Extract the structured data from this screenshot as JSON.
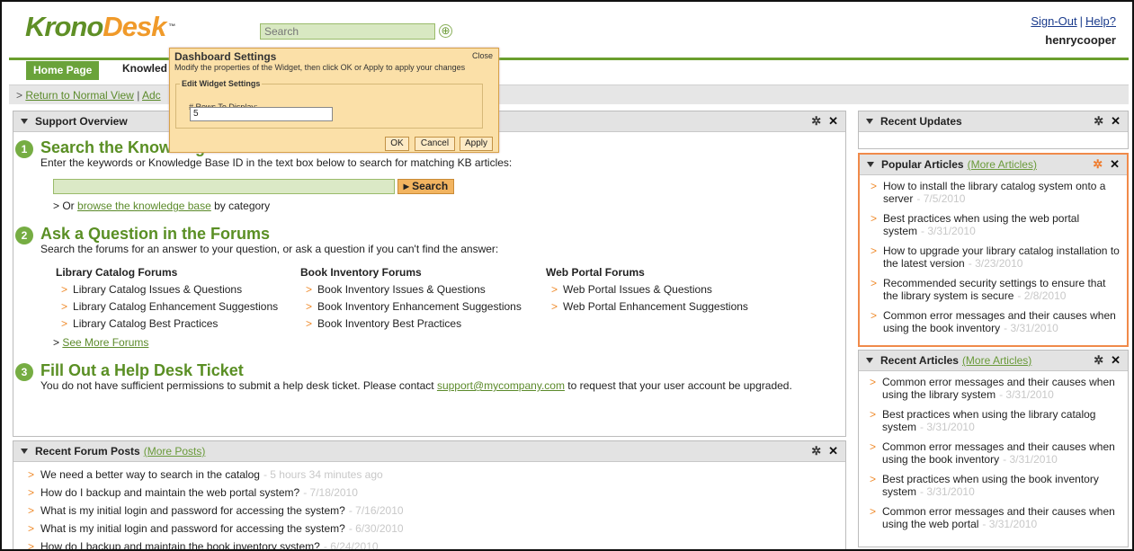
{
  "header": {
    "logo_part1": "Krono",
    "logo_part2": "Desk",
    "logo_tm": "™",
    "search_placeholder": "Search",
    "signout": "Sign-Out",
    "separator": "|",
    "help": "Help?",
    "username": "henrycooper"
  },
  "nav": {
    "home_tab": "Home Page",
    "kb_tab": "Knowled"
  },
  "breadcrumb": {
    "prefix": ">",
    "return_link": "Return to Normal View",
    "sep": "|",
    "add_link": "Adc"
  },
  "dialog": {
    "title": "Dashboard Settings",
    "close": "Close",
    "message": "Modify the properties of the Widget, then click OK or Apply to apply your changes",
    "legend": "Edit Widget Settings",
    "rows_label": "# Rows To Display:",
    "rows_value": "5",
    "ok": "OK",
    "cancel": "Cancel",
    "apply": "Apply"
  },
  "support": {
    "title": "Support Overview",
    "step1": {
      "num": "1",
      "title": "Search the Knowledge Base",
      "desc": "Enter the keywords or Knowledge Base ID in the text box below to search for matching KB articles:",
      "button": "Search",
      "browse_prefix": "> Or",
      "browse_link": "browse the knowledge base",
      "browse_suffix": "by category"
    },
    "step2": {
      "num": "2",
      "title": "Ask a Question in the Forums",
      "desc": "Search the forums for an answer to your question, or ask a question if you can't find the answer:",
      "columns": [
        {
          "heading": "Library Catalog Forums",
          "items": [
            "Library Catalog Issues & Questions",
            "Library Catalog Enhancement Suggestions",
            "Library Catalog Best Practices"
          ]
        },
        {
          "heading": "Book Inventory Forums",
          "items": [
            "Book Inventory Issues & Questions",
            "Book Inventory Enhancement Suggestions",
            "Book Inventory Best Practices"
          ]
        },
        {
          "heading": "Web Portal Forums",
          "items": [
            "Web Portal Issues & Questions",
            "Web Portal Enhancement Suggestions"
          ]
        }
      ],
      "more_prefix": ">",
      "more_link": "See More Forums"
    },
    "step3": {
      "num": "3",
      "title": "Fill Out a Help Desk Ticket",
      "desc_before": "You do not have sufficient permissions to submit a help desk ticket. Please contact",
      "email": "support@mycompany.com",
      "desc_after": "to request that your user account be upgraded."
    }
  },
  "forum_posts": {
    "title": "Recent Forum Posts",
    "more": "(More Posts)",
    "items": [
      {
        "text": "We need a better way to search in the catalog",
        "date": "- 5 hours 34 minutes ago"
      },
      {
        "text": "How do I backup and maintain the web portal system?",
        "date": "- 7/18/2010"
      },
      {
        "text": "What is my initial login and password for accessing the system?",
        "date": "- 7/16/2010"
      },
      {
        "text": "What is my initial login and password for accessing the system?",
        "date": "- 6/30/2010"
      },
      {
        "text": "How do I backup and maintain the book inventory system?",
        "date": "- 6/24/2010"
      }
    ]
  },
  "recent_updates": {
    "title": "Recent Updates"
  },
  "popular": {
    "title": "Popular Articles",
    "more": "(More Articles)",
    "items": [
      {
        "text": "How to install the library catalog system onto a server",
        "date": "- 7/5/2010"
      },
      {
        "text": "Best practices when using the web portal system",
        "date": "- 3/31/2010"
      },
      {
        "text": "How to upgrade your library catalog installation to the latest version",
        "date": "- 3/23/2010"
      },
      {
        "text": "Recommended security settings to ensure that the library system is secure",
        "date": "- 2/8/2010"
      },
      {
        "text": "Common error messages and their causes when using the book inventory",
        "date": "- 3/31/2010"
      }
    ]
  },
  "recent_articles": {
    "title": "Recent Articles",
    "more": "(More Articles)",
    "items": [
      {
        "text": "Common error messages and their causes when using the library system",
        "date": "- 3/31/2010"
      },
      {
        "text": "Best practices when using the library catalog system",
        "date": "- 3/31/2010"
      },
      {
        "text": "Common error messages and their causes when using the book inventory",
        "date": "- 3/31/2010"
      },
      {
        "text": "Best practices when using the book inventory system",
        "date": "- 3/31/2010"
      },
      {
        "text": "Common error messages and their causes when using the web portal",
        "date": "- 3/31/2010"
      }
    ]
  },
  "icons": {
    "gear": "gear-icon",
    "close": "close-icon",
    "collapse": "collapse-triangle-icon",
    "bullet": "orange-arrow-icon"
  },
  "colors": {
    "brand_green": "#5f8f26",
    "brand_orange": "#f09a2a",
    "dialog_bg": "#fbe0a8",
    "popular_border": "#f08a4a"
  }
}
